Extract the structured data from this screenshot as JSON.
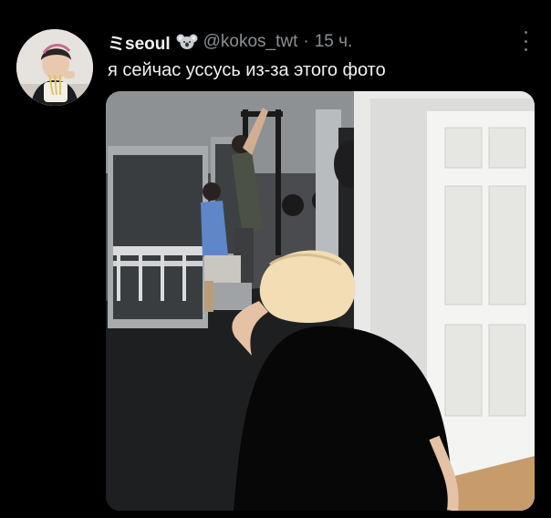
{
  "tweet": {
    "display_name": "ミseoul",
    "badge_icon": "koala-icon",
    "handle": "@kokos_twt",
    "separator": "·",
    "time": "15 ч.",
    "text": "я сейчас уссусь из-за этого фото",
    "more_icon": "vertical-ellipsis-icon",
    "avatar_icon": "user-avatar-photo",
    "media": {
      "kind": "photo"
    }
  },
  "colors": {
    "background": "#000000",
    "primary_text": "#e7e9ea",
    "secondary_text": "#8b8f94"
  }
}
